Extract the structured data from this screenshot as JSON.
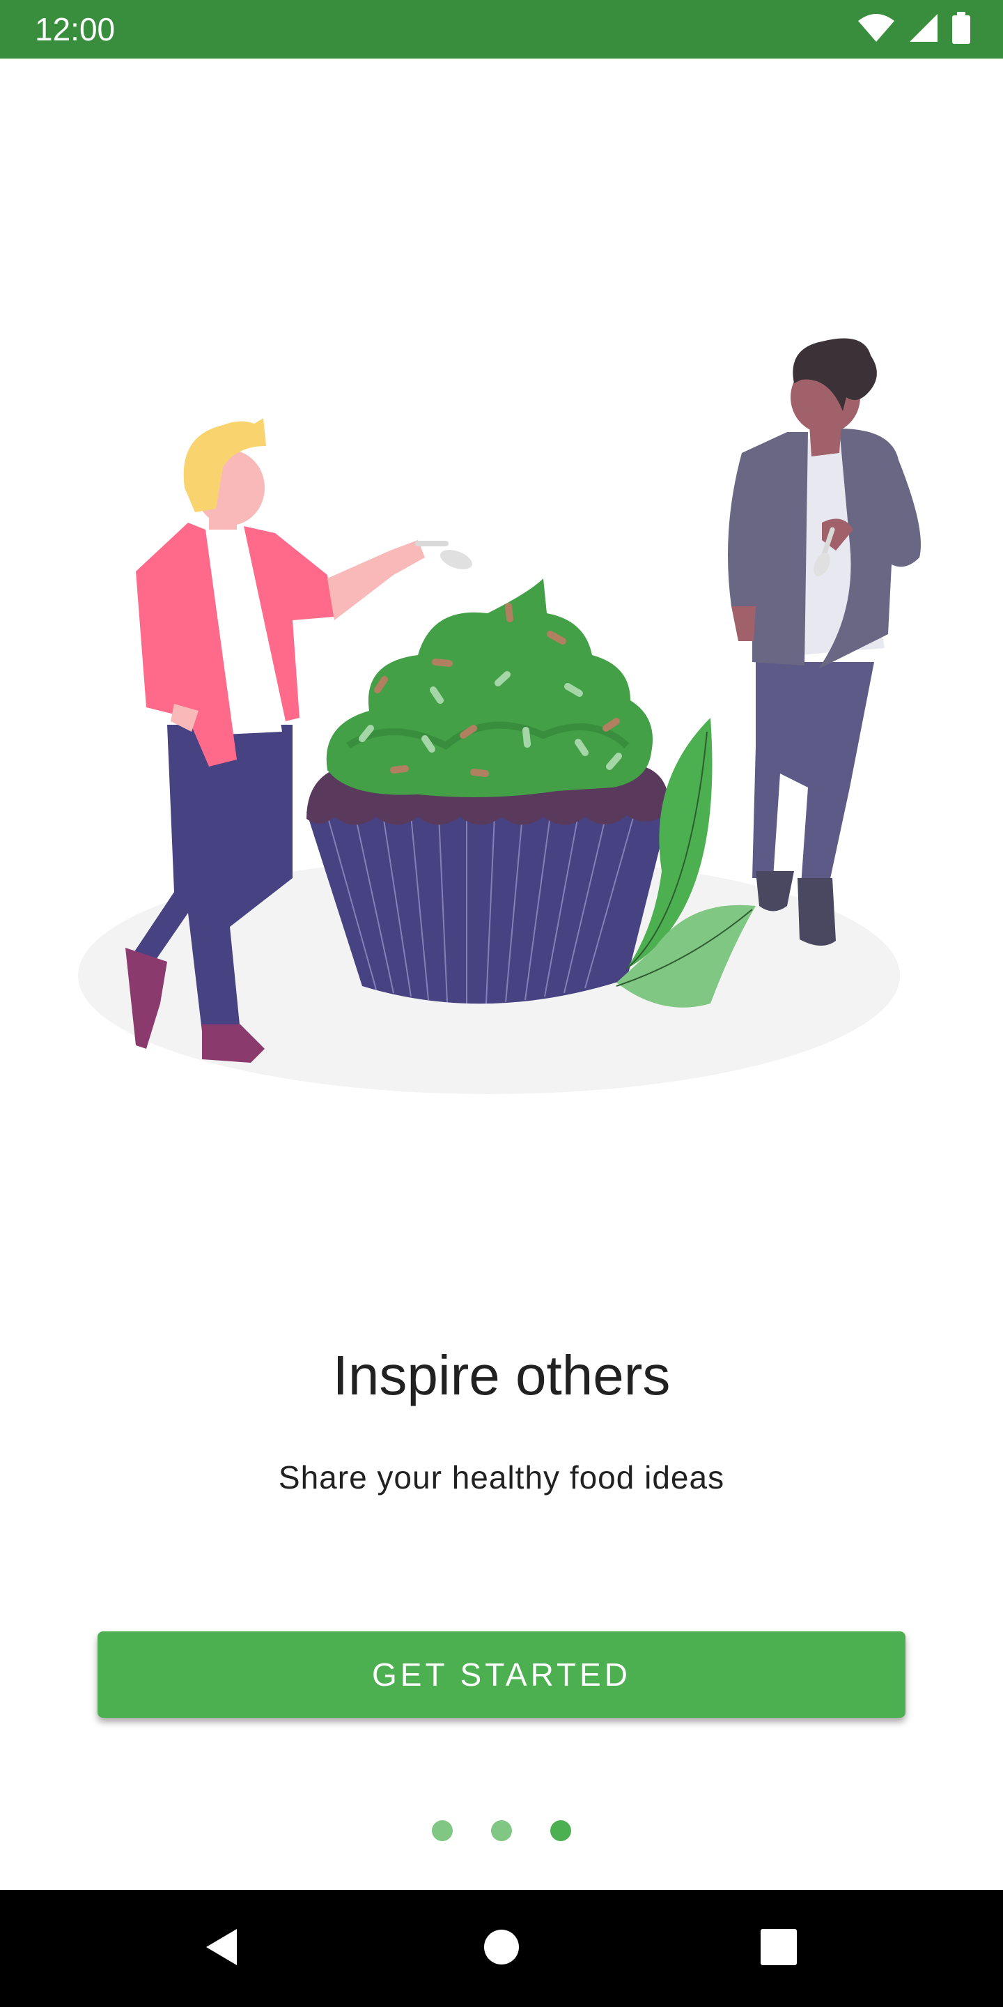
{
  "status_bar": {
    "time": "12:00",
    "icons": [
      "wifi-icon",
      "cellular-signal-icon",
      "battery-icon"
    ],
    "background": "#388E3C"
  },
  "onboarding": {
    "title": "Inspire others",
    "subtitle": "Share your healthy food ideas",
    "button_label": "GET STARTED",
    "page_count": 3,
    "current_page": 3
  },
  "colors": {
    "accent": "#4CAF50",
    "indicator_inactive": "#81C784",
    "status_bar": "#388E3C"
  },
  "nav_bar": {
    "icons": [
      "back-icon",
      "home-icon",
      "recents-icon"
    ]
  }
}
